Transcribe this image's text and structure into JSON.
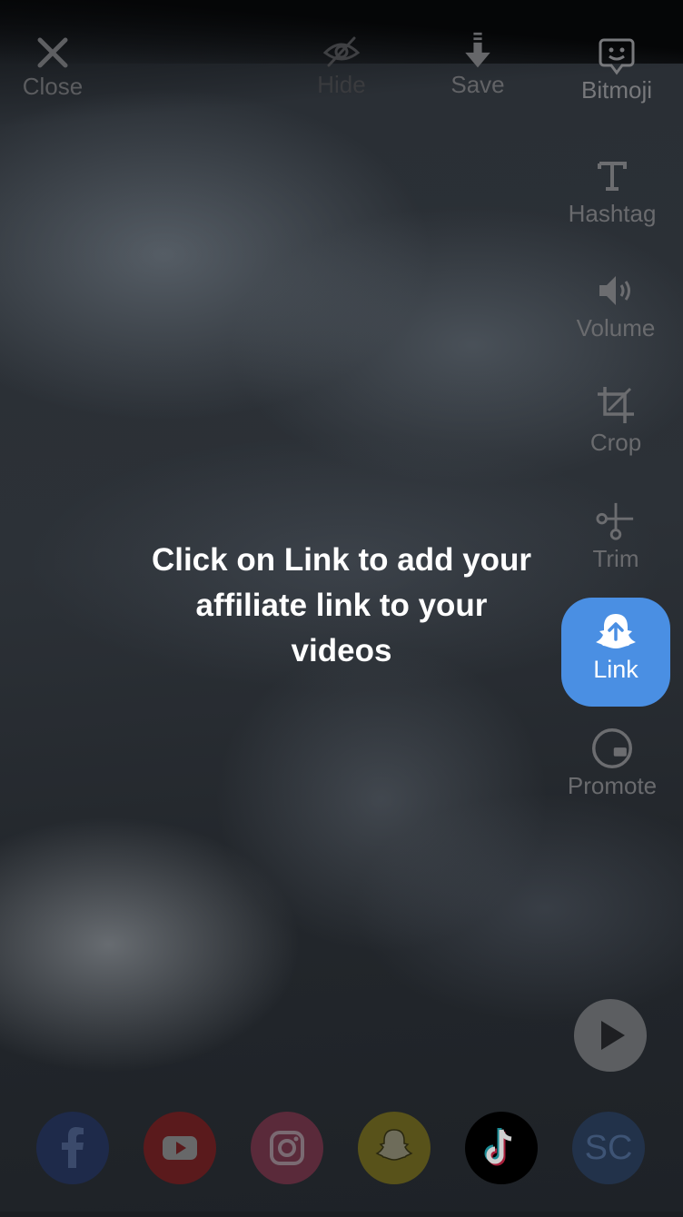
{
  "top_bar": {
    "close_label": "Close",
    "hide_label": "Hide",
    "save_label": "Save",
    "bitmoji_label": "Bitmoji"
  },
  "side_toolbar": {
    "hashtag_label": "Hashtag",
    "volume_label": "Volume",
    "crop_label": "Crop",
    "trim_label": "Trim",
    "link_label": "Link",
    "promote_label": "Promote"
  },
  "hint": {
    "line1": "Click on Link to add your",
    "line2": "affiliate link to your",
    "line3": "videos"
  },
  "share": {
    "soundcloud_label": "SC"
  },
  "colors": {
    "link_accent": "#4a8fe3",
    "facebook": "#1e2a4a",
    "youtube": "#5a1a1c",
    "instagram": "#5a2a3a",
    "snapchat": "#58521a",
    "tiktok": "#000000",
    "soundcloud": "#22324a"
  }
}
